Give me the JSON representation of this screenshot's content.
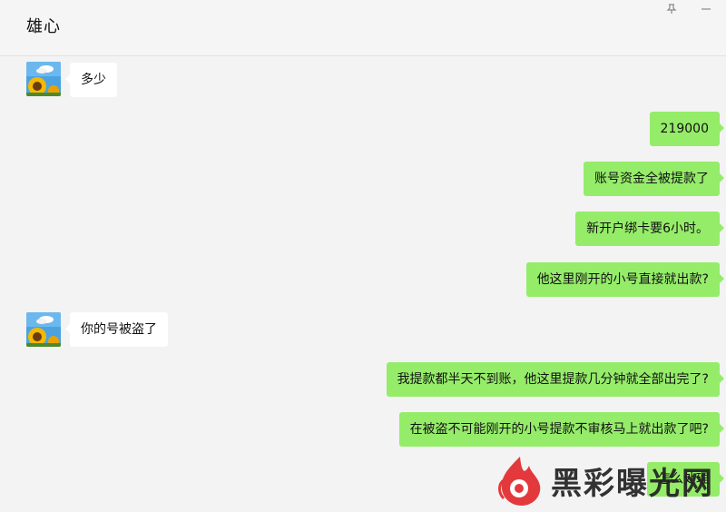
{
  "header": {
    "title": "雄心"
  },
  "window_controls": {
    "pin_icon": "pin-icon",
    "minimize_icon": "minimize-icon"
  },
  "messages": [
    {
      "side": "in",
      "text": "多少"
    },
    {
      "side": "out",
      "text": "219000"
    },
    {
      "side": "out",
      "text": "账号资金全被提款了"
    },
    {
      "side": "out",
      "text": "新开户绑卡要6小时。"
    },
    {
      "side": "out",
      "text": "他这里刚开的小号直接就出款?"
    },
    {
      "side": "in",
      "text": "你的号被盗了"
    },
    {
      "side": "out",
      "text": "我提款都半天不到账，他这里提款几分钟就全部出完了?"
    },
    {
      "side": "out",
      "text": "在被盗不可能刚开的小号提款不审核马上就出款了吧?"
    },
    {
      "side": "out",
      "text": "怎么处理"
    }
  ],
  "watermark": {
    "text": "黑彩曝光网",
    "logo_icon": "flame-logo-icon"
  },
  "colors": {
    "outgoing_bubble": "#95ec69",
    "incoming_bubble": "#ffffff",
    "background": "#f3f3f3",
    "watermark_logo": "#e4393c"
  }
}
